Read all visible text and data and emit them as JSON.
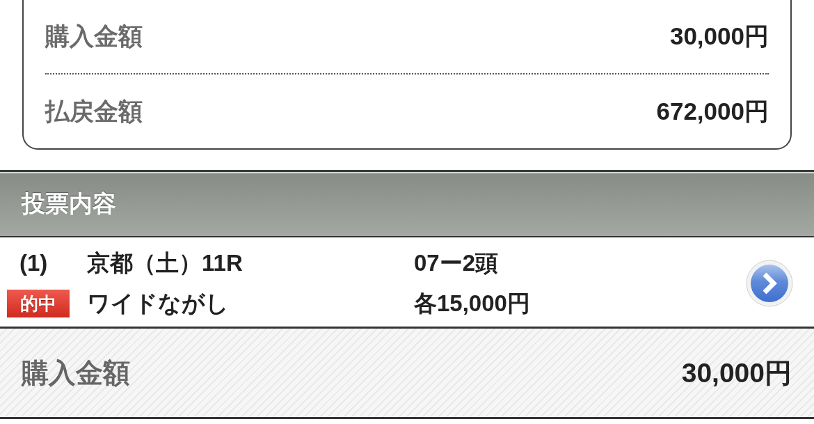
{
  "summary": {
    "rows": [
      {
        "label": "購入金額",
        "value": "30,000円"
      },
      {
        "label": "払戻金額",
        "value": "672,000円"
      }
    ]
  },
  "section": {
    "title": "投票内容"
  },
  "bets": [
    {
      "number": "(1)",
      "race": "京都（土）11R",
      "combination": "07ー2頭",
      "badge": "的中",
      "bet_type": "ワイドながし",
      "amount": "各15,000円"
    }
  ],
  "total": {
    "label": "購入金額",
    "value": "30,000円"
  }
}
